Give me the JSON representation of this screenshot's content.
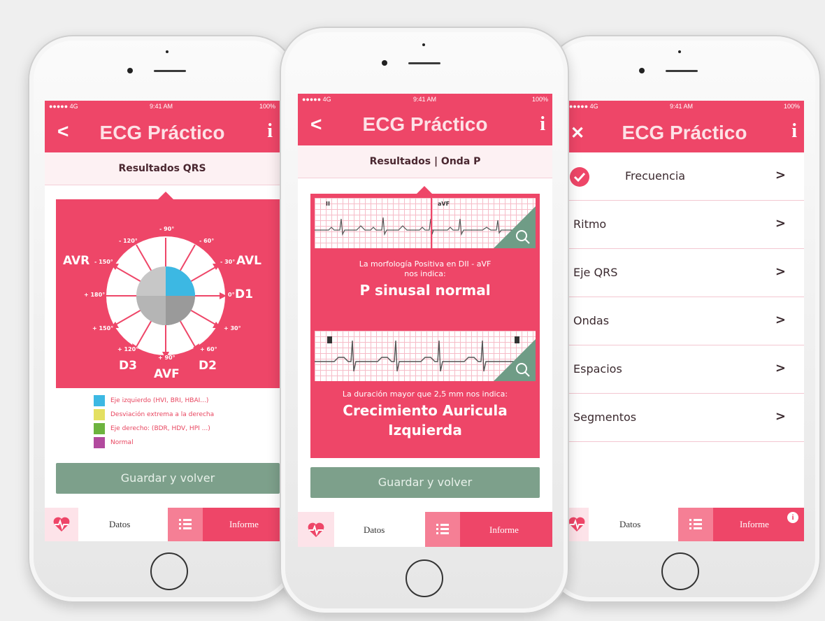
{
  "status": {
    "carrier": "●●●●● 4G",
    "time": "9:41 AM",
    "battery": "100%"
  },
  "app": {
    "title": "ECG Práctico",
    "back": "<",
    "close": "✕",
    "info": "i"
  },
  "colors": {
    "primary": "#ee4668",
    "save": "#7da08b",
    "blue": "#3cb8e3",
    "yellow": "#e4e061",
    "green": "#6db33f",
    "purple": "#b24a9e"
  },
  "screen1": {
    "subheader": "Resultados QRS",
    "leads": {
      "avr": "AVR",
      "avl": "AVL",
      "d1": "D1",
      "d3": "D3",
      "avf": "AVF",
      "d2": "D2"
    },
    "degrees": {
      "m90": "- 90°",
      "m120": "- 120°",
      "m60": "- 60°",
      "m150": "- 150°",
      "m30": "- 30°",
      "p180": "+ 180°",
      "p0": "0°",
      "p150": "+ 150°",
      "p30": "+ 30°",
      "p120": "+ 120°",
      "p90": "+ 90°",
      "p60": "+ 60°"
    },
    "legend": [
      {
        "label": "Eje izquierdo (HVI, BRI, HBAI...)"
      },
      {
        "label": "Desviación extrema a la derecha"
      },
      {
        "label": "Eje derecho: (BDR, HDV, HPI ...)"
      },
      {
        "label": "Normal"
      }
    ],
    "save": "Guardar y volver",
    "tabs": {
      "datos": "Datos",
      "informe": "Informe"
    }
  },
  "screen2": {
    "subheader": "Resultados | Onda P",
    "strip_label_a": "II",
    "strip_label_b": "aVF",
    "text1": "La morfología Positiva en DII - aVF",
    "text1b": "nos indica:",
    "result1": "P sinusal normal",
    "text2": "La duración mayor que 2,5 mm nos indica:",
    "result2_line1": "Crecimiento Auricula",
    "result2_line2": "Izquierda",
    "save": "Guardar y volver",
    "tabs": {
      "datos": "Datos",
      "informe": "Informe"
    }
  },
  "screen3": {
    "menu": [
      {
        "label": "Frecuencia",
        "checked": true
      },
      {
        "label": "Ritmo"
      },
      {
        "label": "Eje QRS"
      },
      {
        "label": "Ondas"
      },
      {
        "label": "Espacios"
      },
      {
        "label": "Segmentos"
      }
    ],
    "chevron": ">",
    "tabs": {
      "datos": "Datos",
      "informe": "Informe"
    },
    "informe_badge": "i"
  }
}
